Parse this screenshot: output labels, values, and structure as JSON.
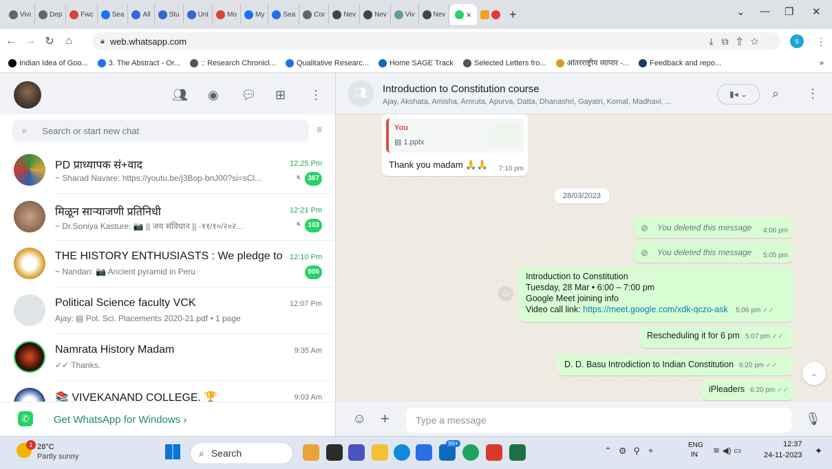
{
  "browser": {
    "tabs": [
      "Vivi",
      "Dep",
      "Fwc",
      "Sea",
      "All",
      "Stu",
      "Unt",
      "Mo",
      "My",
      "Sea",
      "Cor",
      "Nev",
      "Nev",
      "Viv",
      "Nev"
    ],
    "active_tab_close": "×",
    "new_tab": "+",
    "url": "web.whatsapp.com",
    "bookmarks": [
      "Indian Idea of Goo...",
      "3. The Abstract - Or...",
      ":: Research Chronicl...",
      "Qualitative Researc...",
      "Home SAGE Track",
      "Selected Letters fro...",
      "आंतरराष्ट्रीय व्यापार -...",
      "Feedback and repo..."
    ],
    "bookmarks_more": "»",
    "profile_initial": "s"
  },
  "sidebar": {
    "search_placeholder": "Search or start new chat",
    "chats": [
      {
        "name": "PD प्राध्यापक सं+वाद",
        "preview": "~ Sharad Navare: https://youtu.be/j3Bop-bnJ00?si=sCl...",
        "time": "12:25 Pm",
        "unread": "367",
        "muted": true
      },
      {
        "name": "मिळून सार्‍याजणी प्रतिनिधी",
        "preview": "~ Dr.Soniya Kasture: 📷 || जय संविधान ||          -११/१०/२०२...",
        "time": "12:21 Pm",
        "unread": "103",
        "muted": true
      },
      {
        "name": "THE HISTORY ENTHUSIASTS : We pledge to ...",
        "preview": "~ Nandan: 📷 Ancient pyramid in Peru",
        "time": "12:10 Pm",
        "unread": "906",
        "muted": false
      },
      {
        "name": "Political Science faculty VCK",
        "preview": "Ajay: ▤ Pol. Sci. Placements 2020-21.pdf • 1 page",
        "time": "12:07 Pm",
        "unread": "",
        "muted": false
      },
      {
        "name": "Namrata History Madam",
        "preview": "✓✓ Thanks.",
        "time": "9:35 Am",
        "unread": "",
        "muted": false
      },
      {
        "name": "📚 VIVEKANAND COLLEGE. 🏆",
        "preview": "",
        "time": "9:03 Am",
        "unread": "",
        "muted": false
      }
    ],
    "get_app": "Get WhatsApp for Windows ›"
  },
  "conversation": {
    "group_name": "Introduction to Constitution course",
    "members": "Ajay, Akshata, Amisha, Amruta, Apurva, Datta, Dhanashri, Gayatri, Komal, Madhavi, ...",
    "reply_author": "You",
    "reply_file": "▤ 1.pptx",
    "thank_you": "Thank you madam 🙏🙏",
    "thank_you_time": "7:10 pm",
    "date_pill": "28/03/2023",
    "deleted_1": "You deleted this message",
    "deleted_1_time": "4:06 pm",
    "deleted_2": "You deleted this message",
    "deleted_2_time": "5:05 pm",
    "event_title": "Introduction to Constitution",
    "event_when": "Tuesday, 28 Mar  •  6:00 – 7:00 pm",
    "event_meet": "Google Meet joining info",
    "event_link_label": "Video call link: ",
    "event_link": "https://meet.google.com/xdk-qczo-ask",
    "event_time": "5:06 pm",
    "msg_resched": "Rescheduling it for 6 pm",
    "msg_resched_time": "5:07 pm",
    "msg_basu": "D. D. Basu Introdiction to Indian Constitution",
    "msg_basu_time": "6:20 pm",
    "msg_ipleaders": "iPleaders",
    "msg_ipleaders_time": "6:20 pm",
    "input_placeholder": "Type a message"
  },
  "taskbar": {
    "temp": "28°C",
    "weather": "Partly sunny",
    "search": "Search",
    "badge_mail": "99+",
    "lang_1": "ENG",
    "lang_2": "IN",
    "clock_time": "12:37",
    "clock_date": "24-11-2023",
    "weather_badge": "1"
  }
}
